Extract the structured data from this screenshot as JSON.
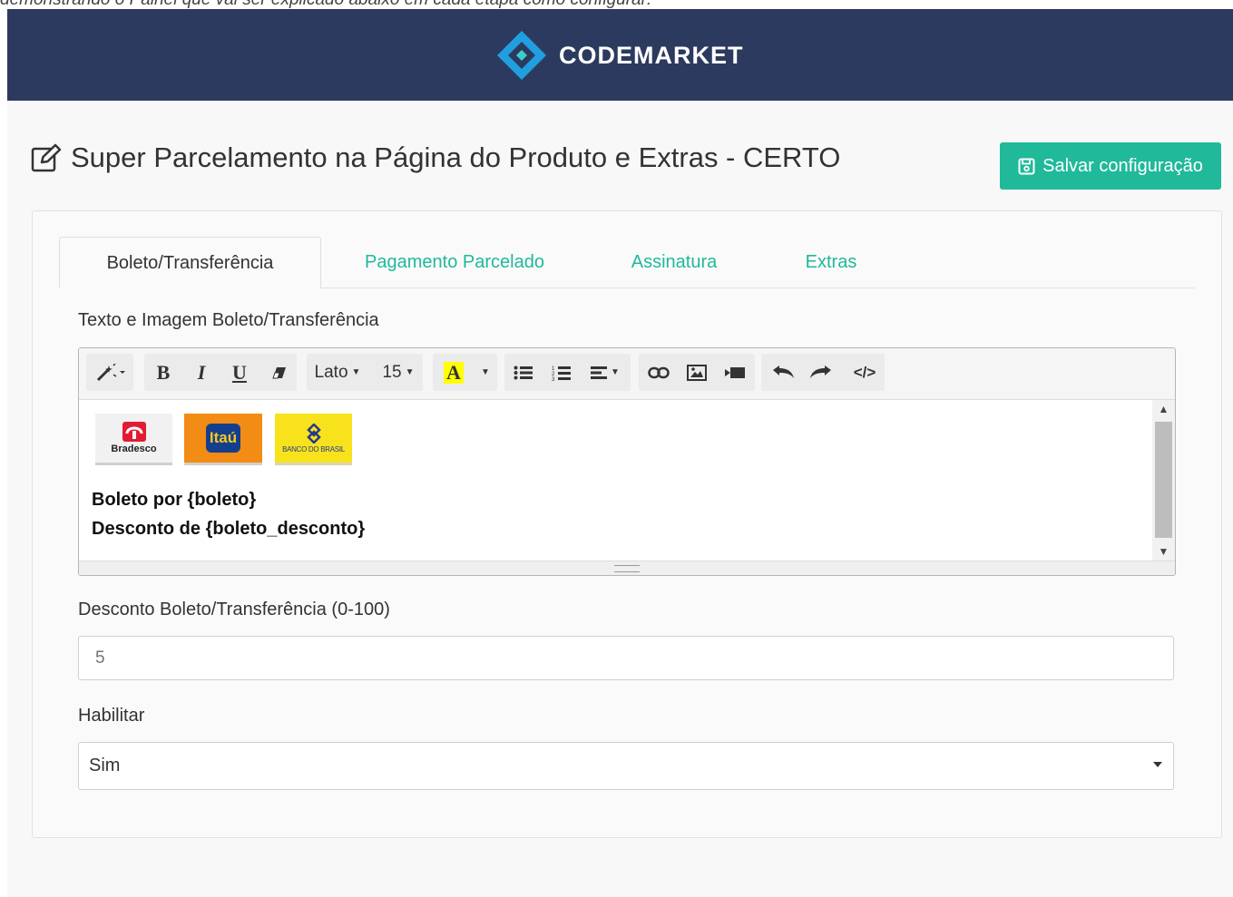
{
  "caption": "demonstrando o Painel que vai ser explicado abaixo em cada etapa como configurar:",
  "header": {
    "brand": "CODEMARKET"
  },
  "page": {
    "title": "Super Parcelamento na Página do Produto e Extras - CERTO",
    "save_label": "Salvar configuração"
  },
  "colors": {
    "header_bg": "#2d3a5f",
    "accent": "#20b999"
  },
  "tabs": [
    {
      "label": "Boleto/Transferência",
      "active": true
    },
    {
      "label": "Pagamento Parcelado",
      "active": false
    },
    {
      "label": "Assinatura",
      "active": false
    },
    {
      "label": "Extras",
      "active": false
    }
  ],
  "form": {
    "editor_label": "Texto e Imagem Boleto/Transferência",
    "toolbar": {
      "bold": "B",
      "italic": "I",
      "underline": "U",
      "font_family": "Lato",
      "font_size": "15",
      "color": "A",
      "code_view": "</>"
    },
    "editor_content": {
      "banks": [
        {
          "name": "Bradesco",
          "label": "Bradesco"
        },
        {
          "name": "Itaú",
          "label": "Itaú"
        },
        {
          "name": "Banco do Brasil",
          "label": "BANCO DO BRASIL"
        }
      ],
      "line1": "Boleto por {boleto}",
      "line2": "Desconto de {boleto_desconto}"
    },
    "discount_label": "Desconto Boleto/Transferência (0-100)",
    "discount_placeholder": "5",
    "enable_label": "Habilitar",
    "enable_value": "Sim"
  }
}
